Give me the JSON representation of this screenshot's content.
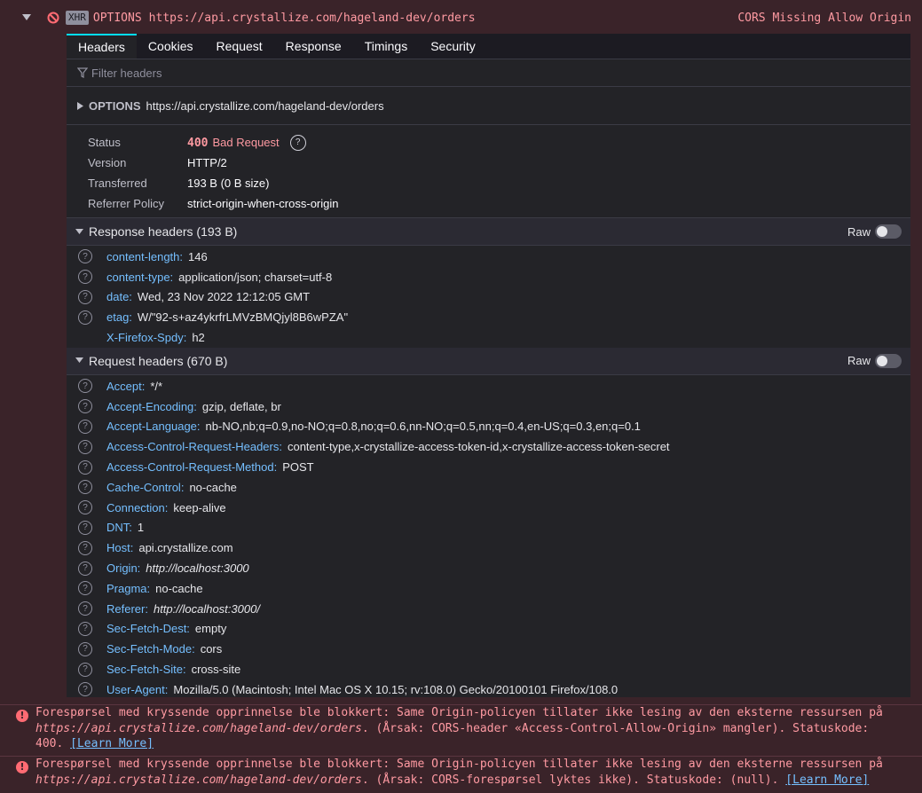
{
  "request": {
    "type": "XHR",
    "method": "OPTIONS",
    "url": "https://api.crystallize.com/hageland-dev/orders",
    "cors_error": "CORS Missing Allow Origin"
  },
  "tabs": [
    "Headers",
    "Cookies",
    "Request",
    "Response",
    "Timings",
    "Security"
  ],
  "active_tab": "Headers",
  "filter_placeholder": "Filter headers",
  "summary": {
    "method": "OPTIONS",
    "url": "https://api.crystallize.com/hageland-dev/orders"
  },
  "meta": {
    "status_label": "Status",
    "status_code": "400",
    "status_text": "Bad Request",
    "version_label": "Version",
    "version": "HTTP/2",
    "transferred_label": "Transferred",
    "transferred": "193 B (0 B size)",
    "referrer_label": "Referrer Policy",
    "referrer": "strict-origin-when-cross-origin"
  },
  "response_headers": {
    "title": "Response headers (193 B)",
    "raw_label": "Raw",
    "items": [
      {
        "name": "content-length:",
        "value": "146"
      },
      {
        "name": "content-type:",
        "value": "application/json; charset=utf-8"
      },
      {
        "name": "date:",
        "value": "Wed, 23 Nov 2022 12:12:05 GMT"
      },
      {
        "name": "etag:",
        "value": "W/\"92-s+az4ykrfrLMVzBMQjyl8B6wPZA\""
      },
      {
        "name": "X-Firefox-Spdy:",
        "value": "h2"
      }
    ]
  },
  "request_headers": {
    "title": "Request headers (670 B)",
    "raw_label": "Raw",
    "items": [
      {
        "name": "Accept:",
        "value": "*/*"
      },
      {
        "name": "Accept-Encoding:",
        "value": "gzip, deflate, br"
      },
      {
        "name": "Accept-Language:",
        "value": "nb-NO,nb;q=0.9,no-NO;q=0.8,no;q=0.6,nn-NO;q=0.5,nn;q=0.4,en-US;q=0.3,en;q=0.1"
      },
      {
        "name": "Access-Control-Request-Headers:",
        "value": "content-type,x-crystallize-access-token-id,x-crystallize-access-token-secret"
      },
      {
        "name": "Access-Control-Request-Method:",
        "value": "POST"
      },
      {
        "name": "Cache-Control:",
        "value": "no-cache"
      },
      {
        "name": "Connection:",
        "value": "keep-alive"
      },
      {
        "name": "DNT:",
        "value": "1"
      },
      {
        "name": "Host:",
        "value": "api.crystallize.com"
      },
      {
        "name": "Origin:",
        "value": "http://localhost:3000"
      },
      {
        "name": "Pragma:",
        "value": "no-cache"
      },
      {
        "name": "Referer:",
        "value": "http://localhost:3000/"
      },
      {
        "name": "Sec-Fetch-Dest:",
        "value": "empty"
      },
      {
        "name": "Sec-Fetch-Mode:",
        "value": "cors"
      },
      {
        "name": "Sec-Fetch-Site:",
        "value": "cross-site"
      },
      {
        "name": "User-Agent:",
        "value": "Mozilla/5.0 (Macintosh; Intel Mac OS X 10.15; rv:108.0) Gecko/20100101 Firefox/108.0"
      }
    ]
  },
  "errors": [
    {
      "line1": "Forespørsel med kryssende opprinnelse ble blokkert: Same Origin-policyen tillater ikke lesing av den eksterne ressursen på",
      "url": "https://api.crystallize.com/hageland-dev/orders",
      "line2": ". (Årsak: CORS-header «Access-Control-Allow-Origin» mangler). Statuskode:",
      "line3": "400.",
      "learn": "[Learn More]"
    },
    {
      "line1": "Forespørsel med kryssende opprinnelse ble blokkert: Same Origin-policyen tillater ikke lesing av den eksterne ressursen på",
      "url": "https://api.crystallize.com/hageland-dev/orders",
      "line2": ". (Årsak: CORS-forespørsel lyktes ikke). Statuskode: (null).",
      "learn": "[Learn More]"
    }
  ]
}
